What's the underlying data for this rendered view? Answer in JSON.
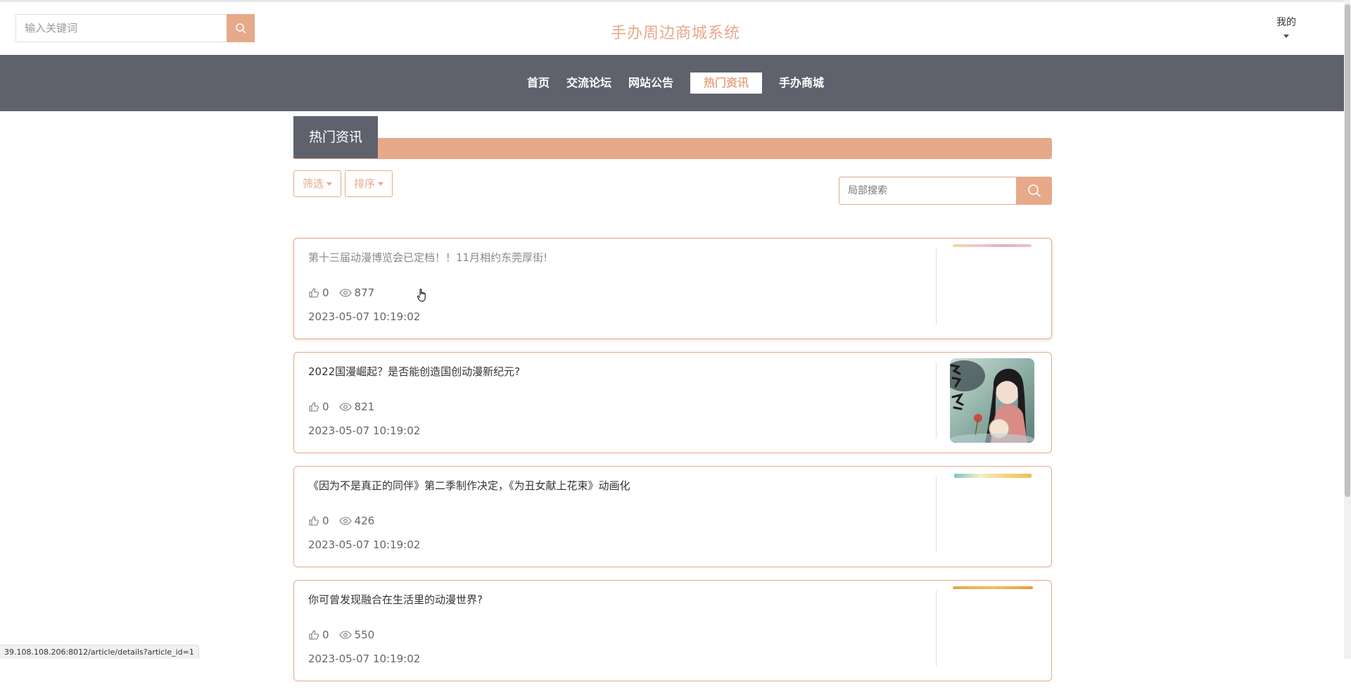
{
  "header": {
    "search_placeholder": "输入关键词",
    "site_title": "手办周边商城系统",
    "user_menu_label": "我的"
  },
  "nav": {
    "items": [
      {
        "label": "首页",
        "active": false
      },
      {
        "label": "交流论坛",
        "active": false
      },
      {
        "label": "网站公告",
        "active": false
      },
      {
        "label": "热门资讯",
        "active": true
      },
      {
        "label": "手办商城",
        "active": false
      }
    ]
  },
  "section": {
    "title": "热门资讯",
    "filter_label": "筛选",
    "sort_label": "排序",
    "local_search_placeholder": "局部搜索"
  },
  "articles": [
    {
      "title": "第十三届动漫博览会已定档！！11月相约东莞厚街!",
      "likes": "0",
      "views": "877",
      "date": "2023-05-07 10:19:02"
    },
    {
      "title": "2022国漫崛起？是否能创造国创动漫新纪元?",
      "likes": "0",
      "views": "821",
      "date": "2023-05-07 10:19:02"
    },
    {
      "title": "《因为不是真正的同伴》第二季制作决定，《为丑女献上花束》动画化",
      "likes": "0",
      "views": "426",
      "date": "2023-05-07 10:19:02"
    },
    {
      "title": "你可曾发现融合在生活里的动漫世界?",
      "likes": "0",
      "views": "550",
      "date": "2023-05-07 10:19:02"
    }
  ],
  "status_url": "39.108.108.206:8012/article/details?article_id=1",
  "colors": {
    "accent": "#e6a98a",
    "nav_bg": "#5f626c"
  }
}
